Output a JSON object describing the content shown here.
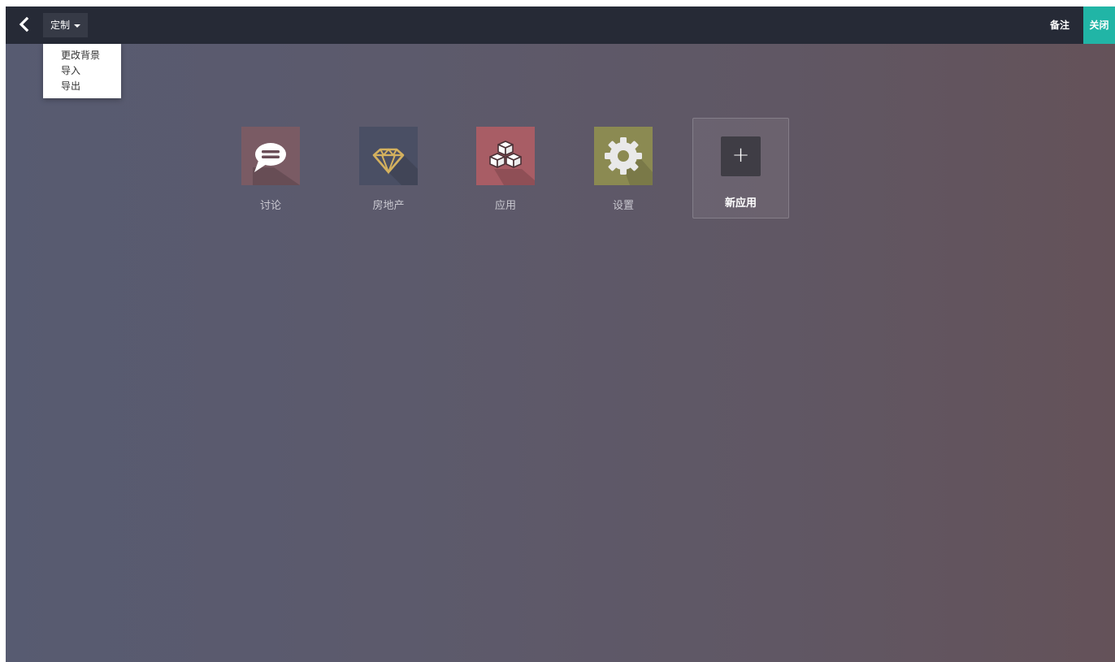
{
  "topbar": {
    "back_icon": "chevron-left-icon",
    "menu_label": "定制",
    "notes_label": "备注",
    "close_label": "关闭"
  },
  "dropdown": {
    "items": [
      {
        "label": "更改背景"
      },
      {
        "label": "导入"
      },
      {
        "label": "导出"
      }
    ]
  },
  "apps": [
    {
      "label": "讨论",
      "icon": "chat-bubble-icon",
      "color": "#7a5b64"
    },
    {
      "label": "房地产",
      "icon": "diamond-icon",
      "color": "#4a4f64"
    },
    {
      "label": "应用",
      "icon": "cubes-icon",
      "color": "#a85d65"
    },
    {
      "label": "设置",
      "icon": "gear-icon",
      "color": "#8b8a52"
    }
  ],
  "new_app": {
    "label": "新应用",
    "icon": "plus-icon",
    "symbol": "+"
  },
  "colors": {
    "topbar": "#262a36",
    "close_accent": "#21b5a6"
  }
}
